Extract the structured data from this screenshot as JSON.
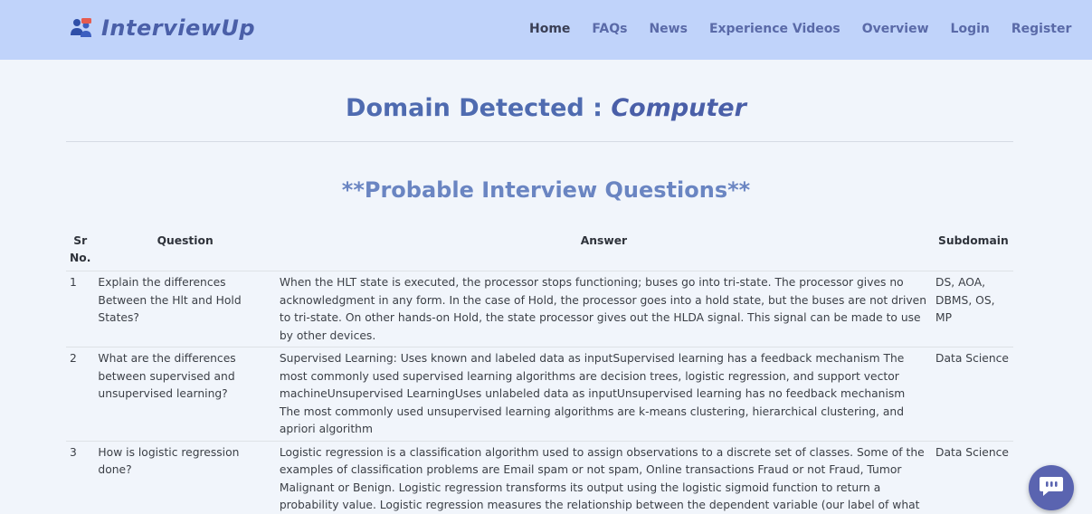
{
  "brand": {
    "name": "InterviewUp",
    "icon": "people-icon"
  },
  "nav": [
    {
      "label": "Home",
      "active": true
    },
    {
      "label": "FAQs"
    },
    {
      "label": "News"
    },
    {
      "label": "Experience Videos"
    },
    {
      "label": "Overview"
    },
    {
      "label": "Login"
    },
    {
      "label": "Register"
    }
  ],
  "domain": {
    "prefix": "Domain Detected : ",
    "value": "Computer"
  },
  "section_title": "**Probable Interview Questions**",
  "table": {
    "headers": {
      "sr": "Sr No.",
      "question": "Question",
      "answer": "Answer",
      "subdomain": "Subdomain"
    },
    "rows": [
      {
        "sr": "1",
        "question": "Explain the differences Between the Hlt and Hold States?",
        "answer": "When the HLT state is executed, the processor stops functioning; buses go into tri-state. The processor gives no acknowledgment in any form. In the case of Hold, the processor goes into a hold state, but the buses are not driven to tri-state. On other hands-on Hold, the state processor gives out the HLDA signal. This signal can be made to use by other devices.",
        "subdomain": "DS, AOA, DBMS, OS, MP"
      },
      {
        "sr": "2",
        "question": "What are the differences between supervised and unsupervised learning?",
        "answer": "Supervised Learning: Uses known and labeled data as inputSupervised learning has a feedback mechanism The most commonly used supervised learning algorithms are decision trees, logistic regression, and support vector machineUnsupervised LearningUses unlabeled data as inputUnsupervised learning has no feedback mechanism The most commonly used unsupervised learning algorithms are k-means clustering, hierarchical clustering, and apriori algorithm",
        "subdomain": "Data Science"
      },
      {
        "sr": "3",
        "question": "How is logistic regression done?",
        "answer": "Logistic regression is a classification algorithm used to assign observations to a discrete set of classes. Some of the examples of classification problems are Email spam or not spam, Online transactions Fraud or not Fraud, Tumor Malignant or Benign. Logistic regression transforms its output using the logistic sigmoid function to return a probability value. Logistic regression measures the relationship between the dependent variable (our label of what we want to",
        "subdomain": "Data Science"
      }
    ]
  },
  "chat_button": {
    "icon": "chat-bubble-icon"
  },
  "colors": {
    "navbar_bg": "#c0d3fa",
    "page_bg": "#f1f5fb",
    "accent": "#4f6bb0",
    "chat_bg": "#5a64b0"
  }
}
